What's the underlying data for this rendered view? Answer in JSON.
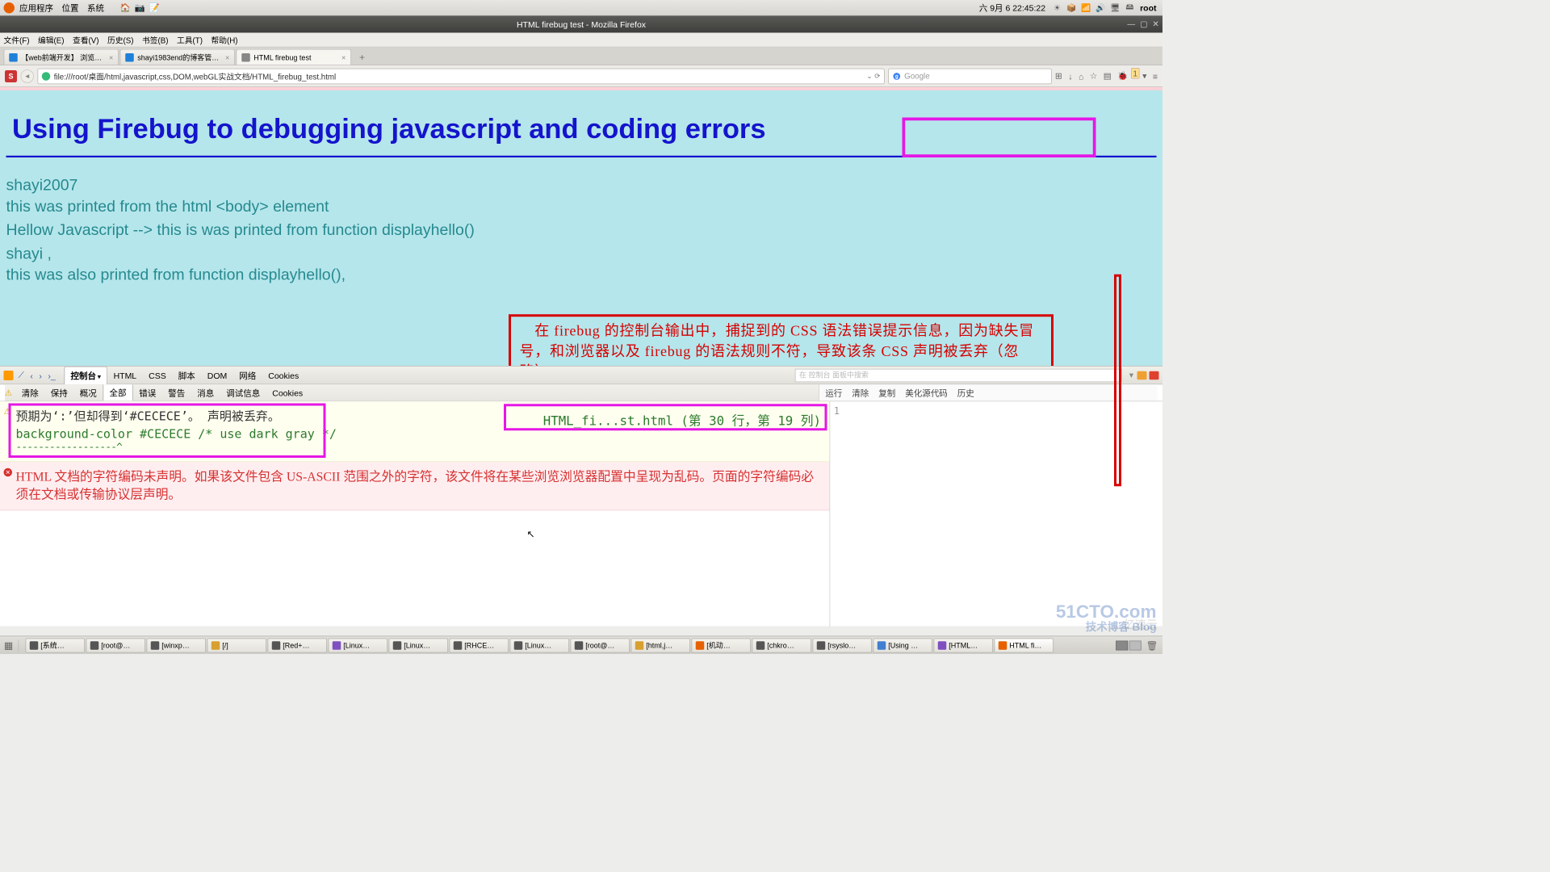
{
  "system": {
    "menus": [
      "应用程序",
      "位置",
      "系统"
    ],
    "clock": "六 9月  6 22:45:22",
    "user": "root"
  },
  "window_title": "HTML firebug test - Mozilla Firefox",
  "browser_menu": [
    "文件(F)",
    "编辑(E)",
    "查看(V)",
    "历史(S)",
    "书签(B)",
    "工具(T)",
    "帮助(H)"
  ],
  "tabs": [
    {
      "label": "【web前端开发】  浏览…",
      "favicon": "#1e80d8"
    },
    {
      "label": "shayi1983end的博客管…",
      "favicon": "#1e80d8"
    },
    {
      "label": "HTML firebug test",
      "favicon": "#888",
      "active": true
    }
  ],
  "url": "file:///root/桌面/html,javascript,css,DOM,webGL实战文档/HTML_firebug_test.html",
  "search_placeholder": "Google",
  "toolbar_badge": "1",
  "page": {
    "h1": "Using Firebug to debugging javascript and coding errors",
    "lines": [
      "shayi2007",
      "this was printed from the html <body> element",
      "",
      "Hellow Javascript --> this is was printed from function displayhello()",
      "",
      "shayi ,",
      "this was also printed from function displayhello(),"
    ]
  },
  "annotation": {
    "text": "　在 firebug 的控制台输出中，捕捉到的 CSS 语法错误提示信息，因为缺失冒号，和浏览器以及 firebug 的语法规则不符，导致该条 CSS 声明被丢弃（忽略），\n对比前面正确的 HTML 文档，可以看到，由于该条声明用于定义 h1 的背景颜色，因此被忽略的结果是，浏览器无法正确渲染 h1 的背景颜色，变成和 body 一样的背景颜色（前面的截图显示出 h1 的背景颜色为灰色，注意这里上方的粉色框处）\n另外，firebug 给出存在语法错误的 HTML 文档名称，以及具体的位置，利用这些信息可以快速定位并修正出错点。"
  },
  "firebug": {
    "tabs": [
      "控制台",
      "HTML",
      "CSS",
      "脚本",
      "DOM",
      "网络",
      "Cookies"
    ],
    "subtabs": [
      "清除",
      "保持",
      "概况",
      "全部",
      "错误",
      "警告",
      "消息",
      "调试信息",
      "Cookies"
    ],
    "right_subtabs": [
      "运行",
      "清除",
      "复制",
      "美化源代码",
      "历史"
    ],
    "search_placeholder": "  在 控制台  面板中搜索",
    "warning": {
      "msg": "预期为‘:’但却得到‘#CECECE’。 声明被丢弃。",
      "code": "background-color #CECECE  /* use dark gray */",
      "dash": "------------------^",
      "file": "HTML_fi...st.html (第 30 行，第 19 列)"
    },
    "error": {
      "msg": "HTML 文档的字符编码未声明。如果该文件包含 US-ASCII 范围之外的字符，该文件将在某些浏览浏览器配置中呈现为乱码。页面的字符编码必须在文档或传输协议层声明。"
    },
    "prompt": "1"
  },
  "taskbar": [
    {
      "label": "[系统…",
      "color": "#555"
    },
    {
      "label": "[root@…",
      "color": "#555"
    },
    {
      "label": "[winxp…",
      "color": "#555"
    },
    {
      "label": "[/]",
      "color": "#d8a030"
    },
    {
      "label": "[Red+…",
      "color": "#555"
    },
    {
      "label": "[Linux…",
      "color": "#8050c0"
    },
    {
      "label": "[Linux…",
      "color": "#555"
    },
    {
      "label": "[RHCE…",
      "color": "#555"
    },
    {
      "label": "[Linux…",
      "color": "#555"
    },
    {
      "label": "[root@…",
      "color": "#555"
    },
    {
      "label": "[html,j…",
      "color": "#d8a030"
    },
    {
      "label": "[机动…",
      "color": "#e66000"
    },
    {
      "label": "[chkro…",
      "color": "#555"
    },
    {
      "label": "[rsyslo…",
      "color": "#555"
    },
    {
      "label": "[Using …",
      "color": "#4080d0"
    },
    {
      "label": "[HTML…",
      "color": "#8050c0"
    },
    {
      "label": "HTML fi…",
      "color": "#e66000",
      "active": true
    }
  ],
  "watermark": {
    "main": "51CTO.com",
    "sub": "技术博客  Blog",
    "yun": "亿速云"
  }
}
